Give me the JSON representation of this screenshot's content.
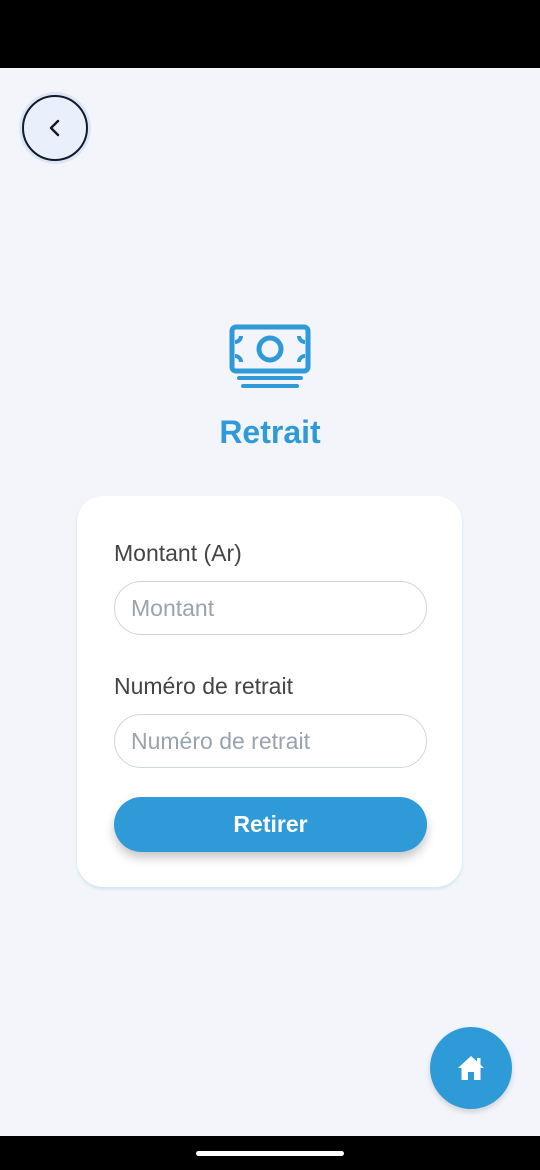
{
  "page": {
    "title": "Retrait"
  },
  "icons": {
    "back": "chevron-left-icon",
    "hero": "money-bill-icon",
    "home": "home-icon"
  },
  "form": {
    "amount_label": "Montant (Ar)",
    "amount_placeholder": "Montant",
    "amount_value": "",
    "withdrawal_label": "Numéro de retrait",
    "withdrawal_placeholder": "Numéro de retrait",
    "withdrawal_value": "",
    "submit_label": "Retirer"
  },
  "colors": {
    "accent": "#2f9ad8",
    "background": "#f3f5fa",
    "card": "#ffffff"
  }
}
